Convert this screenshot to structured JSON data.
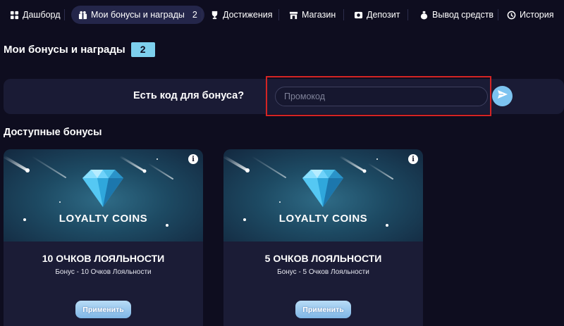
{
  "nav": {
    "items": [
      {
        "label": "Дашборд",
        "icon": "dashboard-icon"
      },
      {
        "label": "Мои бонусы и награды",
        "count": "2",
        "icon": "gift-icon",
        "active": true
      },
      {
        "label": "Достижения",
        "icon": "trophy-icon"
      },
      {
        "label": "Магазин",
        "icon": "store-icon"
      },
      {
        "label": "Депозит",
        "icon": "deposit-icon"
      },
      {
        "label": "Вывод средств",
        "icon": "moneybag-icon"
      },
      {
        "label": "История",
        "icon": "history-icon"
      }
    ]
  },
  "page": {
    "title": "Мои бонусы и награды",
    "badge": "2"
  },
  "promo": {
    "label": "Есть код для бонуса?",
    "placeholder": "Промокод",
    "value": ""
  },
  "section": {
    "title": "Доступные бонусы"
  },
  "cards": [
    {
      "hero_text": "LOYALTY COINS",
      "title": "10 ОЧКОВ ЛОЯЛЬНОСТИ",
      "subtitle": "Бонус - 10 Очков Лояльности",
      "button": "Применить"
    },
    {
      "hero_text": "LOYALTY COINS",
      "title": "5 ОЧКОВ ЛОЯЛЬНОСТИ",
      "subtitle": "Бонус - 5 Очков Лояльности",
      "button": "Применить"
    }
  ],
  "colors": {
    "background": "#0e0d1f",
    "accent": "#7dd0ee",
    "highlight": "#d42424"
  }
}
